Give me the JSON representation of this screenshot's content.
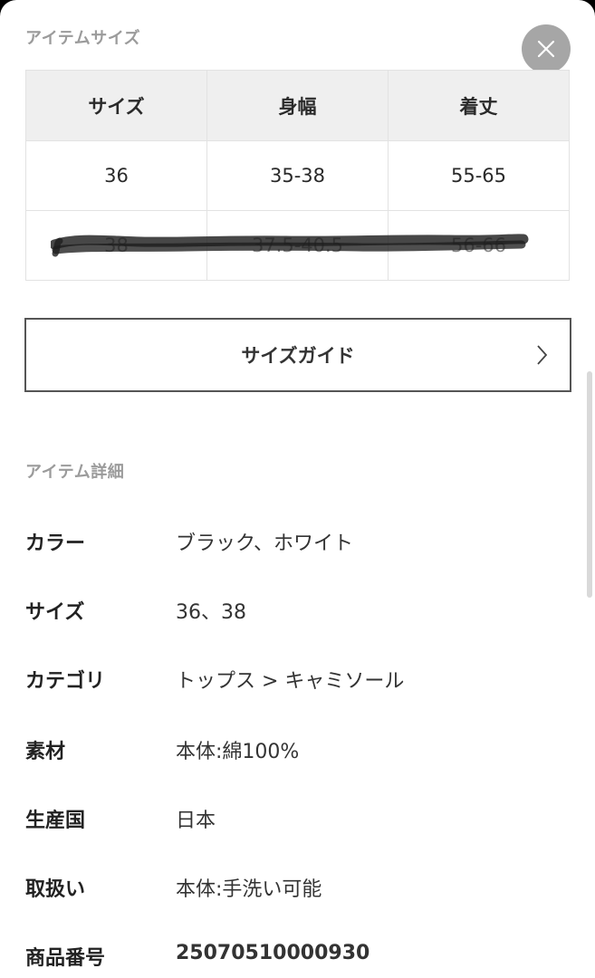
{
  "item_size": {
    "title": "アイテムサイズ",
    "headers": [
      "サイズ",
      "身幅",
      "着丈"
    ],
    "rows": [
      [
        "36",
        "35-38",
        "55-65"
      ],
      [
        "38",
        "37.5-40.5",
        "56-66"
      ]
    ]
  },
  "size_guide": {
    "label": "サイズガイド"
  },
  "item_details": {
    "title": "アイテム詳細",
    "rows": [
      {
        "label": "カラー",
        "value": "ブラック、ホワイト"
      },
      {
        "label": "サイズ",
        "value": "36、38"
      },
      {
        "label": "カテゴリ",
        "value": "トップス > キャミソール"
      },
      {
        "label": "素材",
        "value": "本体:綿100%"
      },
      {
        "label": "生産国",
        "value": "日本"
      },
      {
        "label": "取扱い",
        "value": "本体:手洗い可能"
      },
      {
        "label": "商品番号",
        "value": "25070510000930"
      }
    ]
  },
  "icons": {
    "close": "close-icon",
    "chevron": "chevron-right-icon"
  },
  "colors": {
    "close_button": "#a6a6a6",
    "table_header_bg": "#efefef",
    "section_title": "#9b9b9b"
  }
}
